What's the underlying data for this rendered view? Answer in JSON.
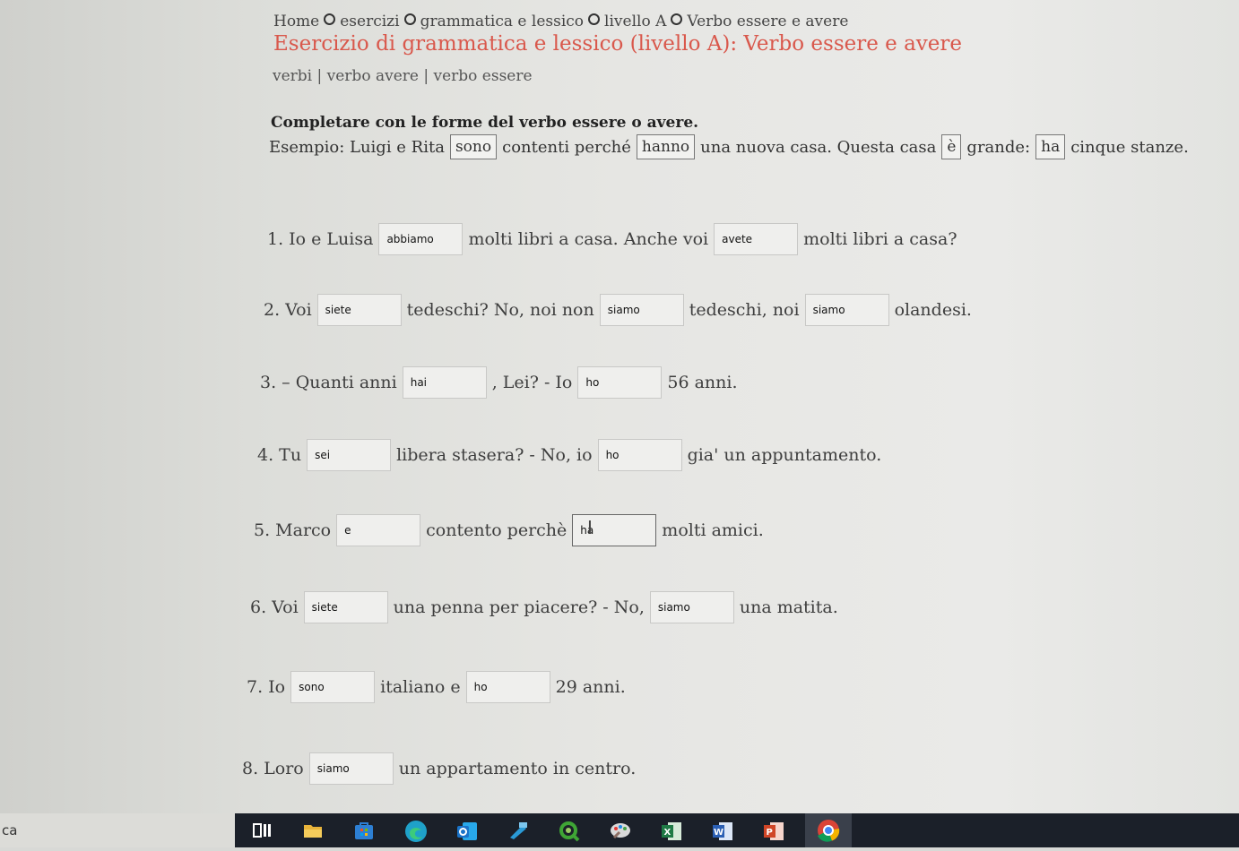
{
  "breadcrumb": [
    "Home",
    "esercizi",
    "grammatica e lessico",
    "livello A",
    "Verbo essere e avere"
  ],
  "title": "Esercizio di grammatica e lessico (livello A): Verbo essere e avere",
  "tags": "verbi | verbo avere | verbo essere",
  "instructions": "Completare con le forme del verbo essere o avere.",
  "example": {
    "p1": "Esempio: Luigi e Rita",
    "b1": "sono",
    "p2": "contenti perché",
    "b2": "hanno",
    "p3": "una nuova casa. Questa casa",
    "b3": "è",
    "p4": "grande:",
    "b4": "ha",
    "p5": "cinque stanze."
  },
  "exercises": [
    {
      "t0": "1. Io e Luisa",
      "a1": "abbiamo",
      "t1": "molti libri a casa. Anche voi",
      "a2": "avete",
      "t2": "molti libri a casa?"
    },
    {
      "t0": "2. Voi",
      "a1": "siete",
      "t1": "tedeschi? No, noi non",
      "a2": "siamo",
      "t2": "tedeschi, noi",
      "a3": "siamo",
      "t3": "olandesi."
    },
    {
      "t0": "3. – Quanti anni",
      "a1": "hai",
      "t1": ", Lei? - Io",
      "a2": "ho",
      "t2": "56 anni."
    },
    {
      "t0": "4. Tu",
      "a1": "sei",
      "t1": "libera stasera? - No, io",
      "a2": "ho",
      "t2": "gia' un appuntamento."
    },
    {
      "t0": "5. Marco",
      "a1": "e",
      "t1": "contento perchè",
      "a2": "ha",
      "t2": "molti amici."
    },
    {
      "t0": "6. Voi",
      "a1": "siete",
      "t1": "una penna per piacere? - No,",
      "a2": "siamo",
      "t2": "una matita."
    },
    {
      "t0": "7. Io",
      "a1": "sono",
      "t1": "italiano e",
      "a2": "ho",
      "t2": "29 anni."
    },
    {
      "t0": "8. Loro",
      "a1": "siamo",
      "t1": "un appartamento in centro."
    }
  ],
  "taskbar": {
    "search_fragment": "ca",
    "icons": [
      "task-view",
      "file-explorer",
      "store",
      "edge",
      "outlook",
      "app-arrow",
      "qlik",
      "paint",
      "excel",
      "word",
      "powerpoint",
      "chrome"
    ],
    "colors": {
      "explorer": "#e8b33a",
      "store": "#2d7fd3",
      "edge": "#1fa1c9",
      "outlook": "#1a73c9",
      "arrow": "#2a9ad6",
      "qlik": "#3fa535",
      "paint": "#d9d9d9",
      "excel": "#1f7a45",
      "word": "#2b5fb4",
      "powerpoint": "#d04526",
      "chrome": "#db4437"
    }
  }
}
